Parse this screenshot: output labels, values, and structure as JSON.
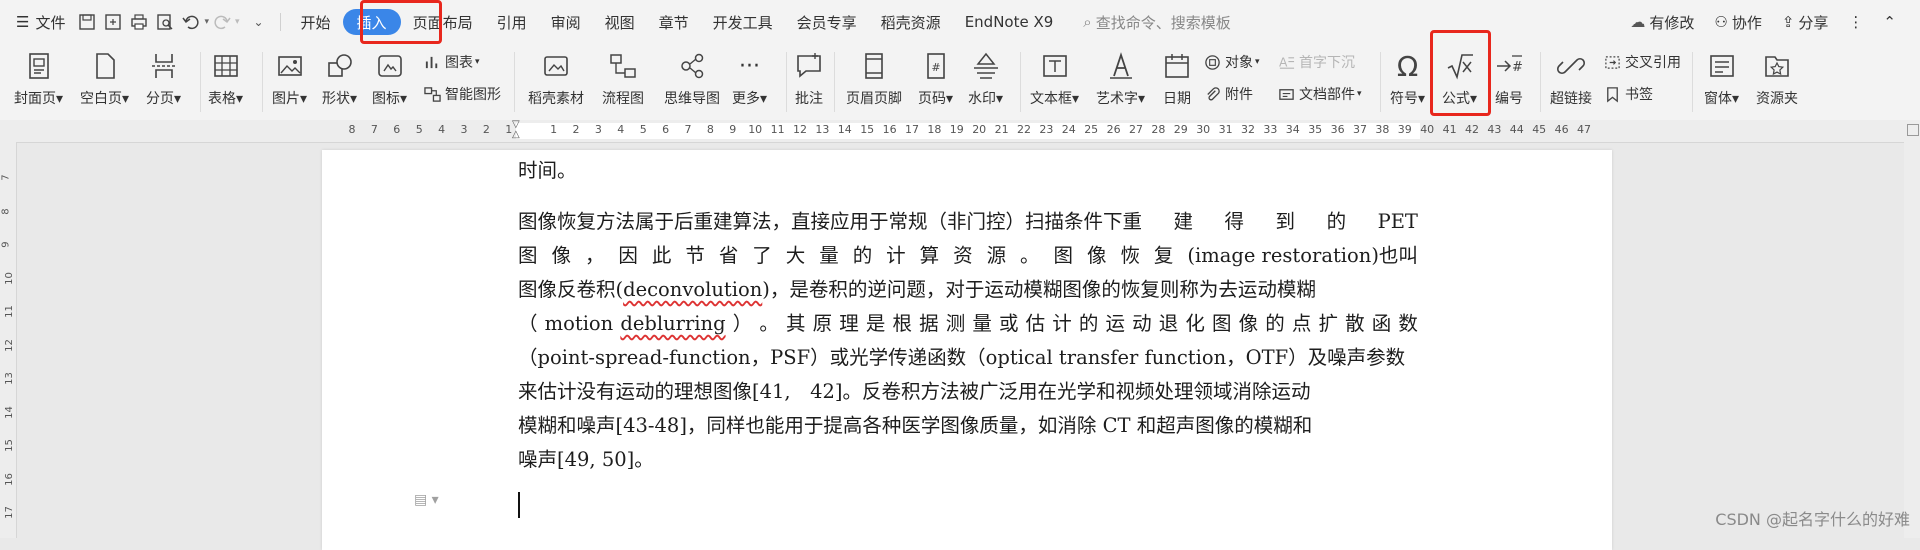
{
  "menubar": {
    "file_label": "文件",
    "tabs": [
      "开始",
      "插入",
      "页面布局",
      "引用",
      "审阅",
      "视图",
      "章节",
      "开发工具",
      "会员专享",
      "稻壳资源",
      "EndNote X9"
    ],
    "active_tab": "插入",
    "search_placeholder": "查找命令、搜索模板",
    "modified_label": "有修改",
    "collab_label": "协作",
    "share_label": "分享"
  },
  "ribbon": {
    "cover": "封面页",
    "blank": "空白页",
    "pagebreak": "分页",
    "table": "表格",
    "picture": "图片",
    "shape": "形状",
    "icon": "图标",
    "chart": "图表",
    "smartart": "智能图形",
    "docer": "稻壳素材",
    "flowchart": "流程图",
    "mindmap": "思维导图",
    "more": "更多",
    "comment": "批注",
    "header_footer": "页眉页脚",
    "page_number": "页码",
    "watermark": "水印",
    "textbox": "文本框",
    "wordart": "艺术字",
    "date": "日期",
    "object": "对象",
    "attachment": "附件",
    "dropcap": "首字下沉",
    "docparts": "文档部件",
    "symbol": "符号",
    "formula": "公式",
    "numbering": "编号",
    "hyperlink": "超链接",
    "crossref": "交叉引用",
    "bookmark": "书签",
    "window": "窗体",
    "resource": "资源夹"
  },
  "ruler": {
    "numbers": [
      "8",
      "7",
      "6",
      "5",
      "4",
      "3",
      "2",
      "1",
      "1",
      "2",
      "3",
      "4",
      "5",
      "6",
      "7",
      "8",
      "9",
      "10",
      "11",
      "12",
      "13",
      "14",
      "15",
      "16",
      "17",
      "18",
      "19",
      "20",
      "21",
      "22",
      "23",
      "24",
      "25",
      "26",
      "27",
      "28",
      "29",
      "30",
      "31",
      "32",
      "33",
      "34",
      "35",
      "36",
      "37",
      "38",
      "39",
      "40",
      "41",
      "42",
      "43",
      "44",
      "45",
      "46",
      "47"
    ],
    "vnumbers": [
      "7",
      "8",
      "9",
      "10",
      "11",
      "12",
      "13",
      "14",
      "15",
      "16",
      "17"
    ]
  },
  "document": {
    "line0": "时间。",
    "line1": [
      "图像恢复方法属于后重建算法，直接应用于常规（非门控）扫描条件下重",
      "建",
      "得",
      "到",
      "的",
      "PET"
    ],
    "line2": [
      "图",
      "像",
      "，",
      "因",
      "此",
      "节",
      "省",
      "了",
      "大",
      "量",
      "的",
      "计",
      "算",
      "资",
      "源",
      "。",
      "图",
      "像",
      "恢",
      "复",
      "(image restoration)也叫"
    ],
    "line3_a": "图像反卷积(",
    "line3_b": "deconvolution",
    "line3_c": ")，是卷积的逆问题，对于运动模糊图像的恢复则称为去运动模糊",
    "line4": [
      "（",
      "motion",
      "deblurring",
      "）",
      "。",
      "其",
      "原",
      "理",
      "是",
      "根",
      "据",
      "测",
      "量",
      "或",
      "估",
      "计",
      "的",
      "运",
      "动",
      "退",
      "化",
      "图",
      "像",
      "的",
      "点",
      "扩",
      "散",
      "函",
      "数"
    ],
    "line5": "（point-spread-function，PSF）或光学传递函数（optical transfer function，OTF）及噪声参数",
    "line6": "来估计没有运动的理想图像[41,　42]。反卷积方法被广泛用在光学和视频处理领域消除运动",
    "line7": "模糊和噪声[43-48]，同样也能用于提高各种医学图像质量，如消除  CT  和超声图像的模糊和",
    "line8": "噪声[49, 50]。"
  },
  "watermark": "CSDN @起名字什么的好难"
}
